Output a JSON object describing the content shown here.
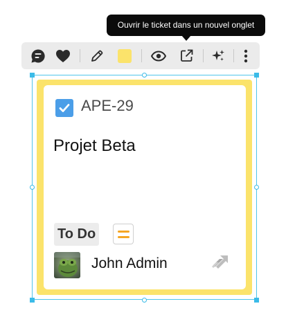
{
  "tooltip": {
    "text": "Ouvrir le ticket dans un nouvel onglet"
  },
  "toolbar": {
    "buttons": [
      {
        "name": "comment-icon"
      },
      {
        "name": "heart-icon"
      },
      {
        "name": "pencil-icon"
      },
      {
        "name": "color-swatch",
        "color": "#fbe36b"
      },
      {
        "name": "eye-icon"
      },
      {
        "name": "open-external-icon"
      },
      {
        "name": "sparkle-icon"
      },
      {
        "name": "more-vertical-icon"
      }
    ]
  },
  "card": {
    "issue_type_icon": "checkbox-icon",
    "key": "APE-29",
    "title": "Projet Beta",
    "status": "To Do",
    "priority_icon": "priority-medium-icon",
    "assignee": "John Admin",
    "avatar": "avatar",
    "app_icon": "jira-icon"
  },
  "colors": {
    "card_background": "#fbe36b",
    "selection": "#3bbbe8",
    "issue_type": "#4b9ee8",
    "priority": "#f5a623"
  }
}
